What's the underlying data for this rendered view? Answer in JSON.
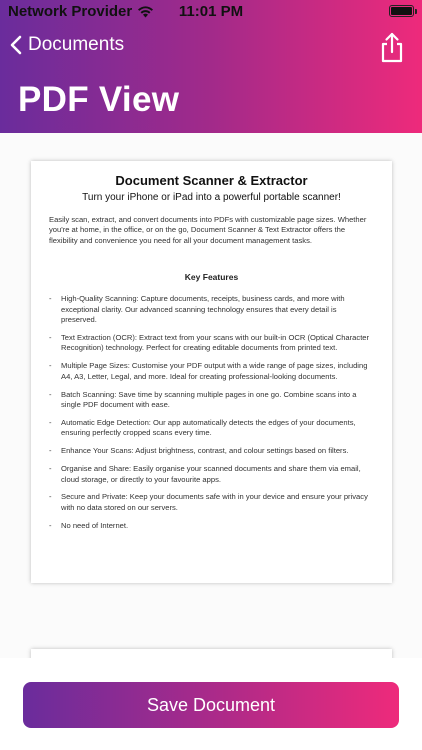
{
  "status_bar": {
    "carrier": "Network Provider",
    "time": "11:01 PM",
    "battery_level": 1.0
  },
  "nav": {
    "back_label": "Documents",
    "title": "PDF View"
  },
  "document": {
    "title": "Document Scanner & Extractor",
    "subtitle": "Turn your iPhone or iPad into a powerful portable scanner!",
    "intro": "Easily scan, extract, and convert documents into PDFs with customizable page sizes. Whether you're at home, in the office, or on the go, Document Scanner & Text Extractor offers the flexibility and convenience you need for all your document management tasks.",
    "key_features_title": "Key Features",
    "features": [
      "High-Quality Scanning: Capture documents, receipts, business cards, and more with exceptional clarity. Our advanced scanning technology ensures that every detail is preserved.",
      "Text Extraction (OCR): Extract text from your scans with our built-in OCR (Optical Character Recognition) technology. Perfect for creating editable documents from printed text.",
      "Multiple Page Sizes: Customise your PDF output with a wide range of page sizes, including A4, A3, Letter, Legal, and more. Ideal for creating professional-looking documents.",
      "Batch Scanning: Save time by scanning multiple pages in one go. Combine scans into a single PDF document with ease.",
      "Automatic Edge Detection: Our app automatically detects the edges of your documents, ensuring perfectly cropped scans every time.",
      "Enhance Your Scans: Adjust brightness, contrast, and colour settings based on filters.",
      "Organise and Share: Easily organise your scanned documents and share them via email, cloud storage, or directly to your favourite apps.",
      "Secure and Private: Keep your documents safe with in your device and ensure your privacy with no data stored on our servers.",
      "No need of Internet."
    ]
  },
  "footer": {
    "save_label": "Save Document"
  },
  "colors": {
    "gradient_start": "#6a2c9c",
    "gradient_end": "#ee2a7b"
  }
}
